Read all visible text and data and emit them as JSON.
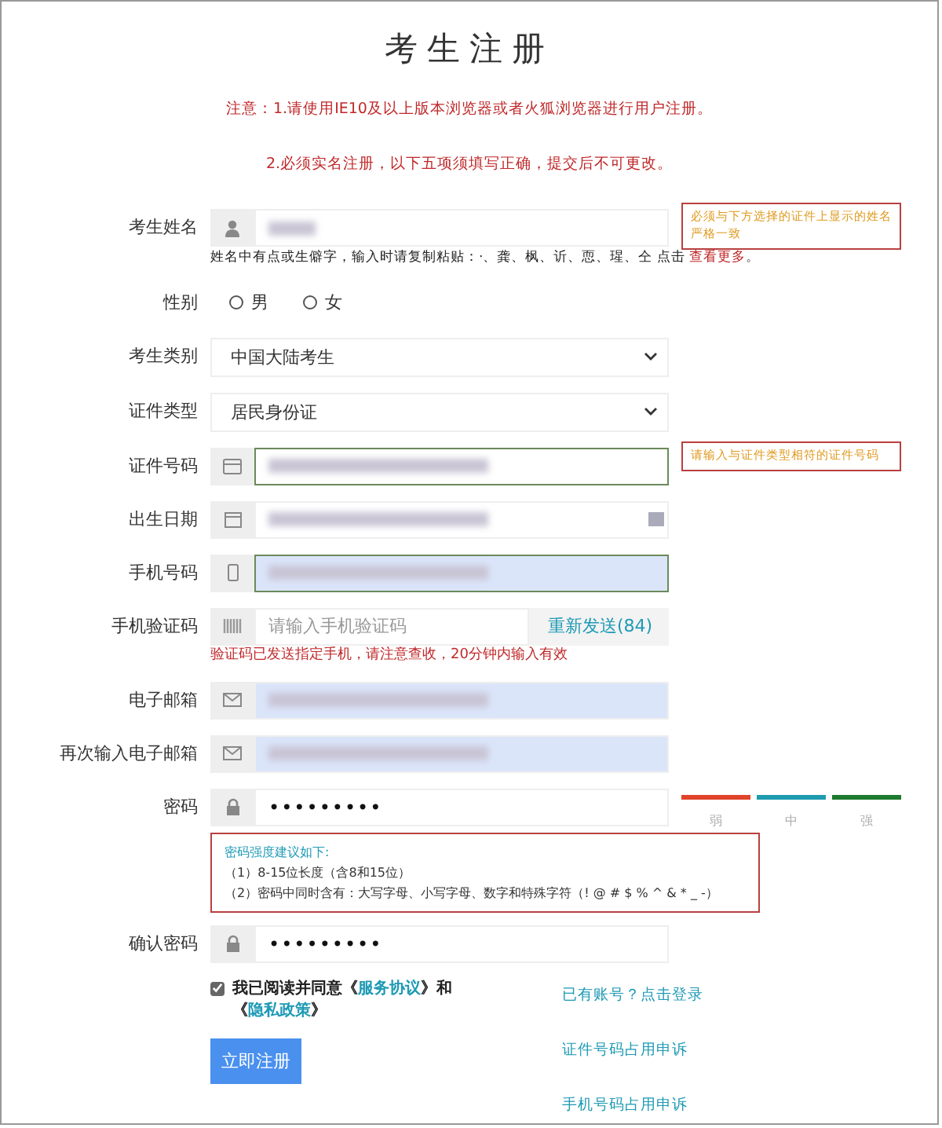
{
  "title": "考生注册",
  "notices": [
    "注意：1.请使用IE10及以上版本浏览器或者火狐浏览器进行用户注册。",
    "2.必须实名注册，以下五项须填写正确，提交后不可更改。"
  ],
  "fields": [
    {
      "kind": "name",
      "label": "考生姓名",
      "filled": true,
      "focused": false,
      "autofill": false,
      "tip": "必须与下方选择的证件上显示的姓名严格一致",
      "hint": "姓名中有点或生僻字，输入时请复制粘贴：·、龚、枫、䜣、恧、瑆、仝 点击 ",
      "hint_link": "查看更多",
      "hint_end": "。"
    },
    {
      "kind": "gender",
      "label": "性别",
      "options": [
        {
          "label": "男",
          "selected": false
        },
        {
          "label": "女",
          "selected": false
        }
      ]
    },
    {
      "kind": "select",
      "label": "考生类别",
      "value": "中国大陆考生"
    },
    {
      "kind": "select",
      "label": "证件类型",
      "value": "居民身份证"
    },
    {
      "kind": "idcard",
      "label": "证件号码",
      "filled": true,
      "focused": true,
      "autofill": false,
      "tip": "请输入与证件类型相符的证件号码"
    },
    {
      "kind": "date",
      "label": "出生日期",
      "filled": true,
      "focused": false,
      "autofill": false
    },
    {
      "kind": "phone",
      "label": "手机号码",
      "filled": true,
      "focused": true,
      "autofill": true
    },
    {
      "kind": "code",
      "label": "手机验证码",
      "placeholder": "请输入手机验证码",
      "resend": "重新发送(84)",
      "message": "验证码已发送指定手机，请注意查收，20分钟内输入有效"
    },
    {
      "kind": "email",
      "label": "电子邮箱",
      "filled": true,
      "focused": false,
      "autofill": true
    },
    {
      "kind": "email",
      "label": "再次输入电子邮箱",
      "filled": true,
      "focused": false,
      "autofill": true
    },
    {
      "kind": "password",
      "label": "密码",
      "value": "•••••••••",
      "strength": [
        {
          "label": "弱",
          "color": "#e0442a"
        },
        {
          "label": "中",
          "color": "#1f9bb0"
        },
        {
          "label": "强",
          "color": "#1d7a2e"
        }
      ],
      "tip_title": "密码强度建议如下:",
      "tip_lines": [
        "（1）8-15位长度（含8和15位）",
        "（2）密码中同时含有：大写字母、小写字母、数字和特殊字符（! @ # $ % ^ & * _ -）"
      ]
    },
    {
      "kind": "password",
      "label": "确认密码",
      "value": "•••••••••"
    }
  ],
  "agree": {
    "checked": true,
    "text": "我已阅读并同意《",
    "link1": "服务协议",
    "mid": "》和《",
    "link2": "隐私政策",
    "end": "》"
  },
  "submit": "立即注册",
  "links": [
    "已有账号？点击登录",
    "证件号码占用申诉",
    "手机号码占用申诉"
  ]
}
